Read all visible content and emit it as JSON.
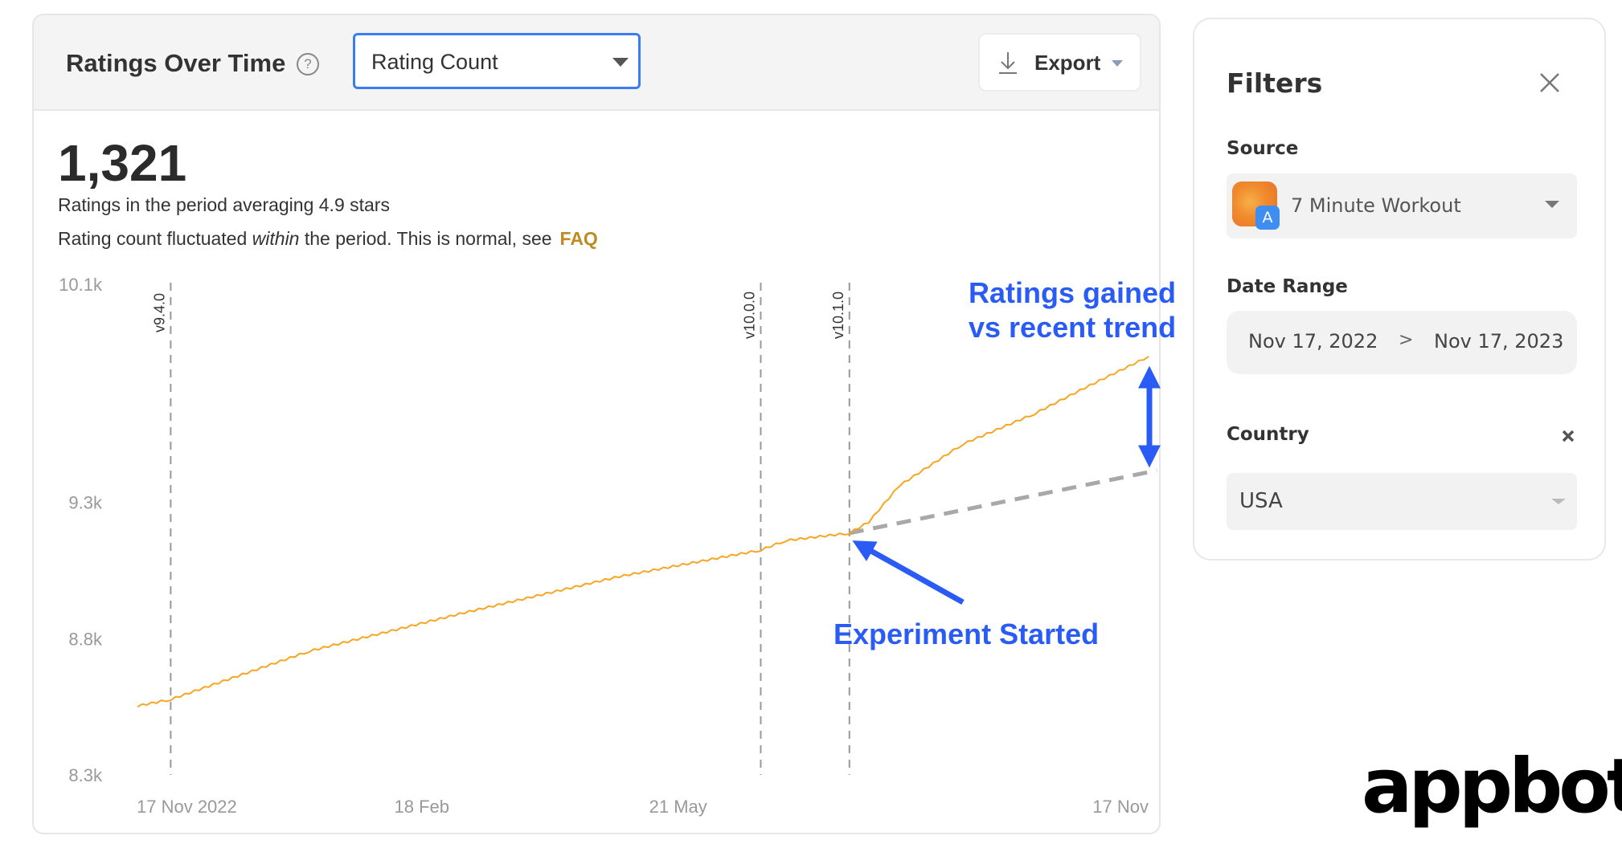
{
  "card": {
    "title": "Ratings Over Time",
    "help_icon": "question-circle-icon",
    "metric_select": {
      "value": "Rating Count"
    },
    "export_label": "Export",
    "total": "1,321",
    "summary": "Ratings in the period averaging 4.9 stars",
    "note_before": "Rating count fluctuated ",
    "note_em": "within",
    "note_after": " the period. This is normal, see",
    "faq_label": "FAQ"
  },
  "chart_data": {
    "type": "line",
    "ylim": [
      8300,
      10100
    ],
    "y_ticks": [
      {
        "value": 10100,
        "label": "10.1k"
      },
      {
        "value": 9300,
        "label": "9.3k"
      },
      {
        "value": 8800,
        "label": "8.8k"
      },
      {
        "value": 8300,
        "label": "8.3k"
      }
    ],
    "x_range": [
      "2022-11-17",
      "2023-11-17"
    ],
    "x_ticks": [
      {
        "date": "2022-11-17",
        "label": "17 Nov 2022"
      },
      {
        "date": "2023-02-18",
        "label": "18 Feb"
      },
      {
        "date": "2023-05-21",
        "label": "21 May"
      },
      {
        "date": "2023-11-17",
        "label": "17 Nov"
      }
    ],
    "grid": false,
    "line_color": "#f5a623",
    "series": [
      {
        "points": [
          [
            "2022-11-17",
            8553
          ],
          [
            "2022-11-29",
            8577
          ],
          [
            "2023-01-18",
            8754
          ],
          [
            "2023-03-15",
            8895
          ],
          [
            "2023-05-10",
            9028
          ],
          [
            "2023-06-30",
            9125
          ],
          [
            "2023-07-09",
            9160
          ],
          [
            "2023-08-01",
            9187
          ],
          [
            "2023-08-08",
            9228
          ],
          [
            "2023-08-19",
            9361
          ],
          [
            "2023-09-11",
            9514
          ],
          [
            "2023-10-07",
            9626
          ],
          [
            "2023-10-25",
            9720
          ],
          [
            "2023-11-17",
            9835
          ]
        ]
      }
    ],
    "trend": {
      "color": "#a8a8a8",
      "points": [
        [
          "2023-08-01",
          9187
        ],
        [
          "2023-11-20",
          9417
        ]
      ]
    },
    "releases": [
      {
        "date": "2022-11-29",
        "label": "v9.4.0"
      },
      {
        "date": "2023-06-30",
        "label": "v10.0.0"
      },
      {
        "date": "2023-08-01",
        "label": "v10.1.0"
      }
    ],
    "annotations": {
      "color": "#2a5cf5",
      "gain_line1": "Ratings gained",
      "gain_line2": "vs recent trend",
      "experiment": "Experiment Started"
    }
  },
  "filters": {
    "title": "Filters",
    "source_label": "Source",
    "source_value": "7 Minute Workout",
    "date_label": "Date Range",
    "date_start": "Nov 17, 2022",
    "date_sep": ">",
    "date_end": "Nov 17, 2023",
    "country_label": "Country",
    "country_value": "USA"
  },
  "logo": "appbot"
}
